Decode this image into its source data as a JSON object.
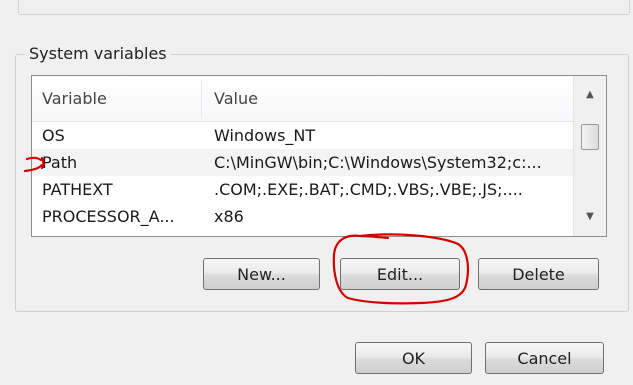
{
  "system_variables": {
    "group_label": "System variables",
    "columns": {
      "variable": "Variable",
      "value": "Value"
    },
    "rows": [
      {
        "variable": "OS",
        "value": "Windows_NT"
      },
      {
        "variable": "Path",
        "value": "C:\\MinGW\\bin;C:\\Windows\\System32;c:..."
      },
      {
        "variable": "PATHEXT",
        "value": ".COM;.EXE;.BAT;.CMD;.VBS;.VBE;.JS;...."
      },
      {
        "variable": "PROCESSOR_A...",
        "value": "x86"
      }
    ],
    "scrollbar": {
      "up_icon": "arrow-up-icon",
      "down_icon": "arrow-down-icon"
    },
    "buttons": {
      "new": "New...",
      "edit": "Edit...",
      "delete": "Delete"
    }
  },
  "dialog_buttons": {
    "ok": "OK",
    "cancel": "Cancel"
  },
  "annotations": {
    "color": "#d40000"
  }
}
